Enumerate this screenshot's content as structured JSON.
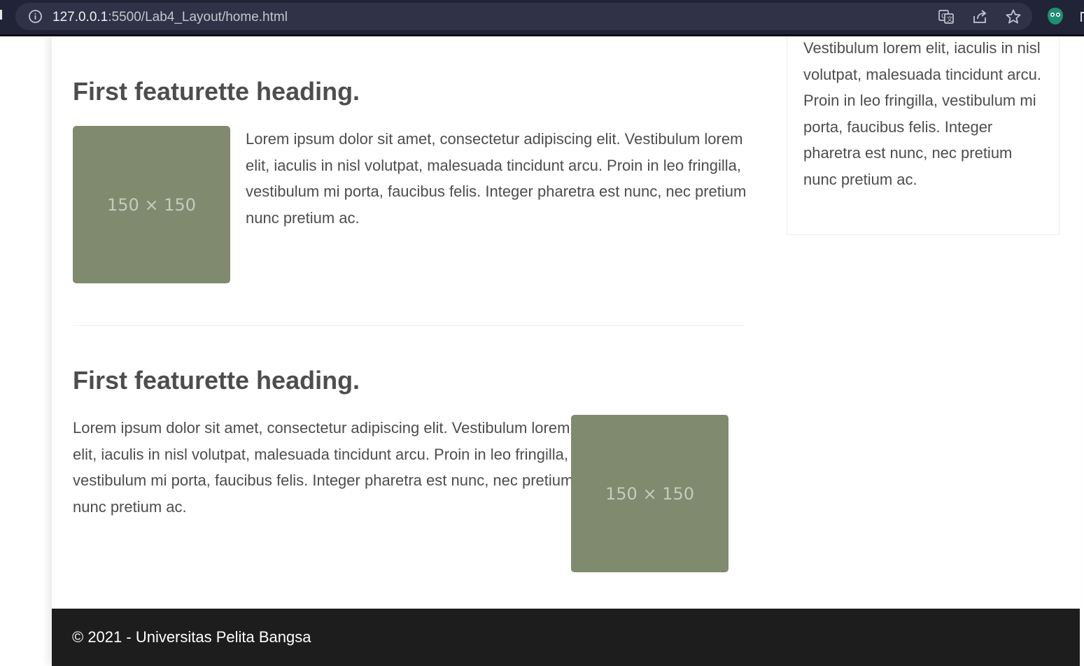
{
  "browser": {
    "url_host": "127.0.0.1",
    "url_rest": ":5500/Lab4_Layout/home.html",
    "icons": [
      "info-icon",
      "translate-icon",
      "share-icon",
      "bookmark-star-icon",
      "extension-icon"
    ]
  },
  "featurettes": [
    {
      "heading": "First featurette heading.",
      "text": "Lorem ipsum dolor sit amet, consectetur adipiscing elit. Vestibulum lorem elit, iaculis in nisl volutpat, malesuada tincidunt arcu. Proin in leo fringilla, vestibulum mi porta, faucibus felis. Integer pharetra est nunc, nec pretium nunc pretium ac.",
      "image_label": "150 × 150",
      "image_position": "left"
    },
    {
      "heading": "First featurette heading.",
      "text": "Lorem ipsum dolor sit amet, consectetur adipiscing elit. Vestibulum lorem elit, iaculis in nisl volutpat, malesuada tincidunt arcu. Proin in leo fringilla, vestibulum mi porta, faucibus felis. Integer pharetra est nunc, nec pretium nunc pretium ac.",
      "image_label": "150 × 150",
      "image_position": "right"
    }
  ],
  "sidebar": {
    "widget_text": "Vestibulum lorem elit, iaculis in nisl volutpat, malesuada tincidunt arcu. Proin in leo fringilla, vestibulum mi porta, faucibus felis. Integer pharetra est nunc, nec pretium nunc pretium ac."
  },
  "footer": {
    "text": "© 2021 - Universitas Pelita Bangsa"
  },
  "colors": {
    "placeholder_bg": "#7f8a6f",
    "text": "#4d4d4d",
    "footer_bg": "#1d1d1d",
    "browser_bar_bg": "#202436"
  }
}
